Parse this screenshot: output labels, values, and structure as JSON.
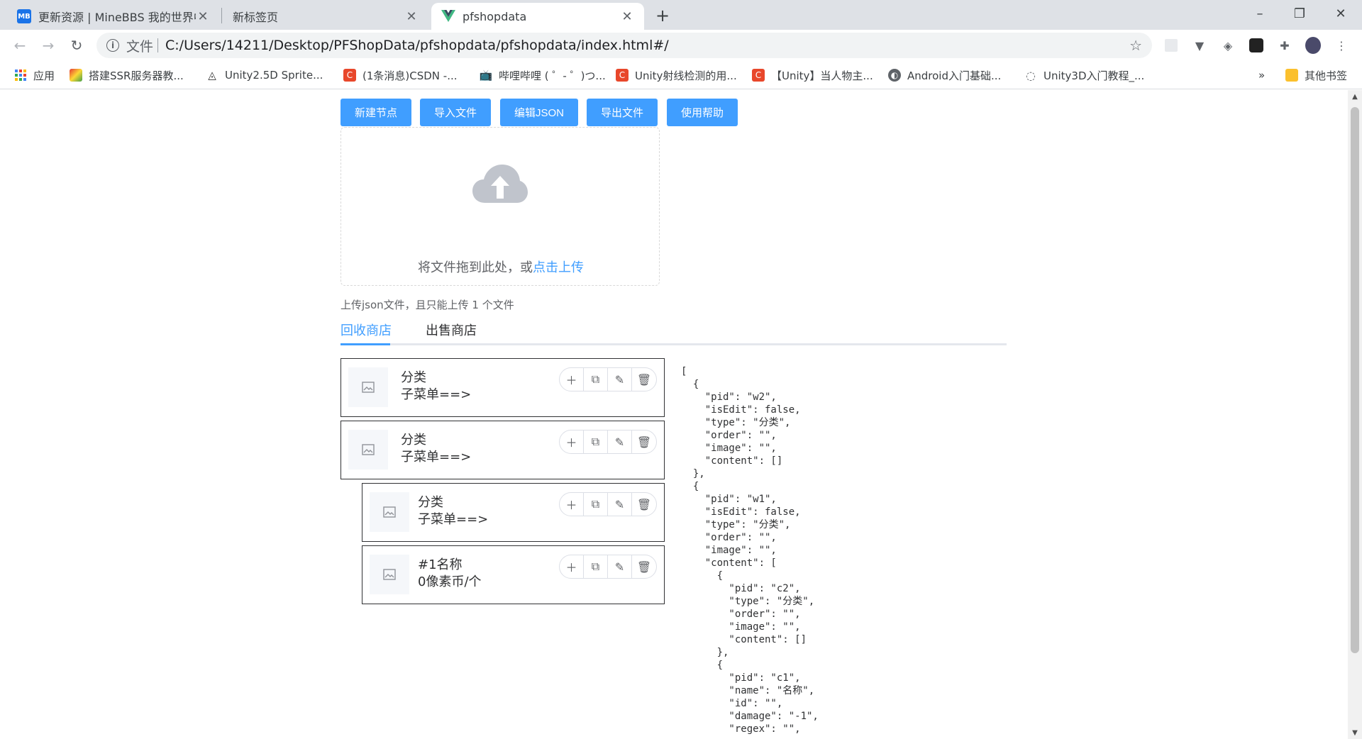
{
  "browser": {
    "tabs": [
      {
        "favicon": "MB",
        "title": "更新资源 | MineBBS 我的世界中",
        "favicon_color": "#1a73e8"
      },
      {
        "favicon": "",
        "title": "新标签页"
      },
      {
        "favicon": "vue-icon",
        "title": "pfshopdata"
      }
    ],
    "scheme_label": "文件",
    "url": "C:/Users/14211/Desktop/PFShopData/pfshopdata/pfshopdata/index.html#/",
    "bookmarks": [
      {
        "label": "应用",
        "icon": "apps-grid-icon"
      },
      {
        "label": "搭建SSR服务器教...",
        "icon": "colorful-icon"
      },
      {
        "label": "Unity2.5D Sprite...",
        "icon": "unity-icon"
      },
      {
        "label": "(1条消息)CSDN -...",
        "icon": "csdn-icon"
      },
      {
        "label": "哔哩哔哩 ( ゜- ゜)つ...",
        "icon": "bilibili-icon"
      },
      {
        "label": "Unity射线检测的用...",
        "icon": "csdn-icon"
      },
      {
        "label": "【Unity】当人物主...",
        "icon": "csdn-icon"
      },
      {
        "label": "Android入门基础...",
        "icon": "globe-icon"
      },
      {
        "label": "Unity3D入门教程_...",
        "icon": "loading-icon"
      }
    ],
    "bookmarks_overflow": "»",
    "other_bookmarks": "其他书签"
  },
  "toolbar": {
    "buttons": [
      "新建节点",
      "导入文件",
      "编辑JSON",
      "导出文件",
      "使用帮助"
    ]
  },
  "upload": {
    "text": "将文件拖到此处，或",
    "link": "点击上传",
    "tip": "上传json文件，且只能上传 1 个文件"
  },
  "shop_tabs": [
    "回收商店",
    "出售商店"
  ],
  "active_tab": 0,
  "nodes": [
    {
      "line1": "分类",
      "line2": "子菜单==>"
    },
    {
      "line1": "分类",
      "line2": "子菜单==>"
    },
    {
      "line1": "分类",
      "line2": "子菜单==>"
    },
    {
      "line1": "#1名称",
      "line2": "0像素币/个"
    }
  ],
  "json_preview": "[\n  {\n    \"pid\": \"w2\",\n    \"isEdit\": false,\n    \"type\": \"分类\",\n    \"order\": \"\",\n    \"image\": \"\",\n    \"content\": []\n  },\n  {\n    \"pid\": \"w1\",\n    \"isEdit\": false,\n    \"type\": \"分类\",\n    \"order\": \"\",\n    \"image\": \"\",\n    \"content\": [\n      {\n        \"pid\": \"c2\",\n        \"type\": \"分类\",\n        \"order\": \"\",\n        \"image\": \"\",\n        \"content\": []\n      },\n      {\n        \"pid\": \"c1\",\n        \"name\": \"名称\",\n        \"id\": \"\",\n        \"damage\": \"-1\",\n        \"regex\": \"\",",
  "colors": {
    "primary": "#409eff",
    "chrome_tabbar": "#dee1e6"
  }
}
